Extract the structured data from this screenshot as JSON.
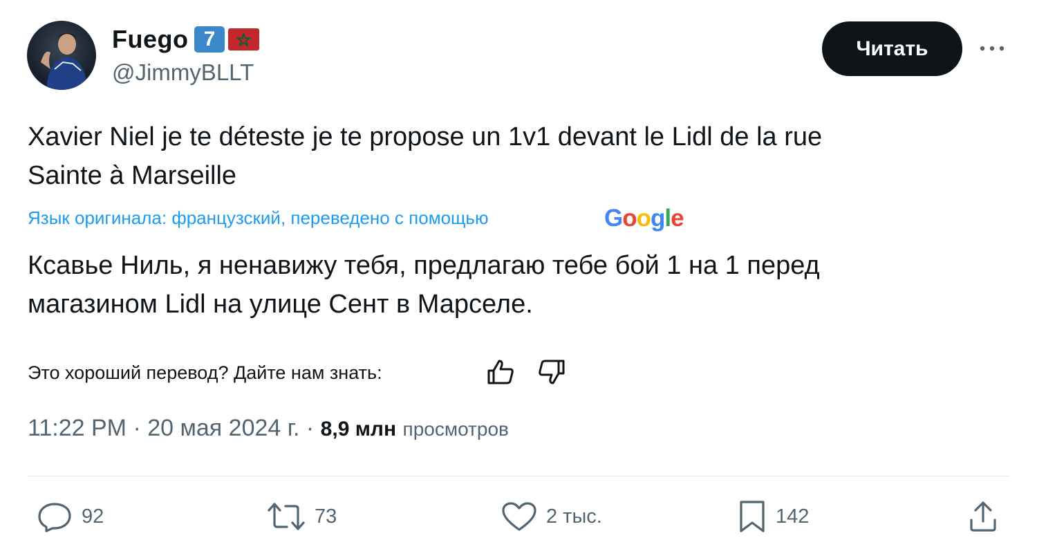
{
  "author": {
    "display_name": "Fuego",
    "badge": "7",
    "flag_icon": "morocco-flag-icon",
    "handle": "@JimmyBLLT"
  },
  "follow_label": "Читать",
  "more_icon": "more-horizontal-icon",
  "tweet": {
    "text_line1": "Xavier Niel je te déteste je te propose un 1v1 devant le Lidl de la rue",
    "text_line2": "Sainte à Marseille"
  },
  "translation": {
    "note": "Язык оригинала: французский, переведено с помощью",
    "provider": "Google",
    "text_line1": "Ксавье Ниль, я ненавижу тебя, предлагаю тебе бой 1 на 1 перед",
    "text_line2": "магазином Lidl на улице Сент в Марселе."
  },
  "feedback": {
    "question": "Это хороший перевод? Дайте нам знать:",
    "up_icon": "thumbs-up-icon",
    "down_icon": "thumbs-down-icon"
  },
  "meta": {
    "time": "11:22 PM",
    "separator": "·",
    "date": "20 мая 2024 г.",
    "views_count": "8,9 млн",
    "views_label": "просмотров"
  },
  "actions": {
    "replies": "92",
    "reposts": "73",
    "likes": "2 тыс.",
    "bookmarks": "142"
  },
  "colors": {
    "link_blue": "#1d9bf0",
    "secondary_text": "#536471",
    "primary_text": "#0f1419",
    "badge_blue": "#3a87c9",
    "flag_red": "#c1272d",
    "flag_star_green": "#006233"
  }
}
